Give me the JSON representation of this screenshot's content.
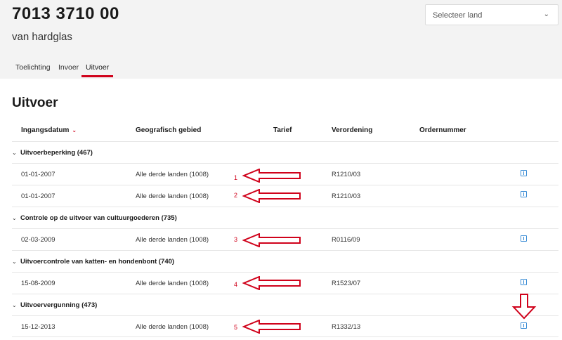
{
  "header": {
    "code": "7013 3710 00",
    "subtitle": "van hardglas",
    "country_select": {
      "placeholder": "Selecteer land"
    }
  },
  "tabs": [
    {
      "label": "Toelichting",
      "active": false
    },
    {
      "label": "Invoer",
      "active": false
    },
    {
      "label": "Uitvoer",
      "active": true
    }
  ],
  "section": {
    "title": "Uitvoer"
  },
  "columns": {
    "date": "Ingangsdatum",
    "area": "Geografisch gebied",
    "tariff": "Tarief",
    "regulation": "Verordening",
    "order": "Ordernummer"
  },
  "groups": [
    {
      "label": "Uitvoerbeperking (467)",
      "rows": [
        {
          "date": "01-01-2007",
          "area": "Alle derde landen (1008)",
          "regulation": "R1210/03",
          "annotation": "1"
        },
        {
          "date": "01-01-2007",
          "area": "Alle derde landen (1008)",
          "regulation": "R1210/03",
          "annotation": "2"
        }
      ]
    },
    {
      "label": "Controle op de uitvoer van cultuurgoederen (735)",
      "rows": [
        {
          "date": "02-03-2009",
          "area": "Alle derde landen (1008)",
          "regulation": "R0116/09",
          "annotation": "3"
        }
      ]
    },
    {
      "label": "Uitvoercontrole van katten- en hondenbont (740)",
      "rows": [
        {
          "date": "15-08-2009",
          "area": "Alle derde landen (1008)",
          "regulation": "R1523/07",
          "annotation": "4"
        }
      ]
    },
    {
      "label": "Uitvoervergunning (473)",
      "rows": [
        {
          "date": "15-12-2013",
          "area": "Alle derde landen (1008)",
          "regulation": "R1332/13",
          "annotation": "5"
        }
      ]
    }
  ],
  "colors": {
    "accent": "#d0021b",
    "link_icon": "#3d8ed6",
    "header_bg": "#f3f3f3"
  }
}
